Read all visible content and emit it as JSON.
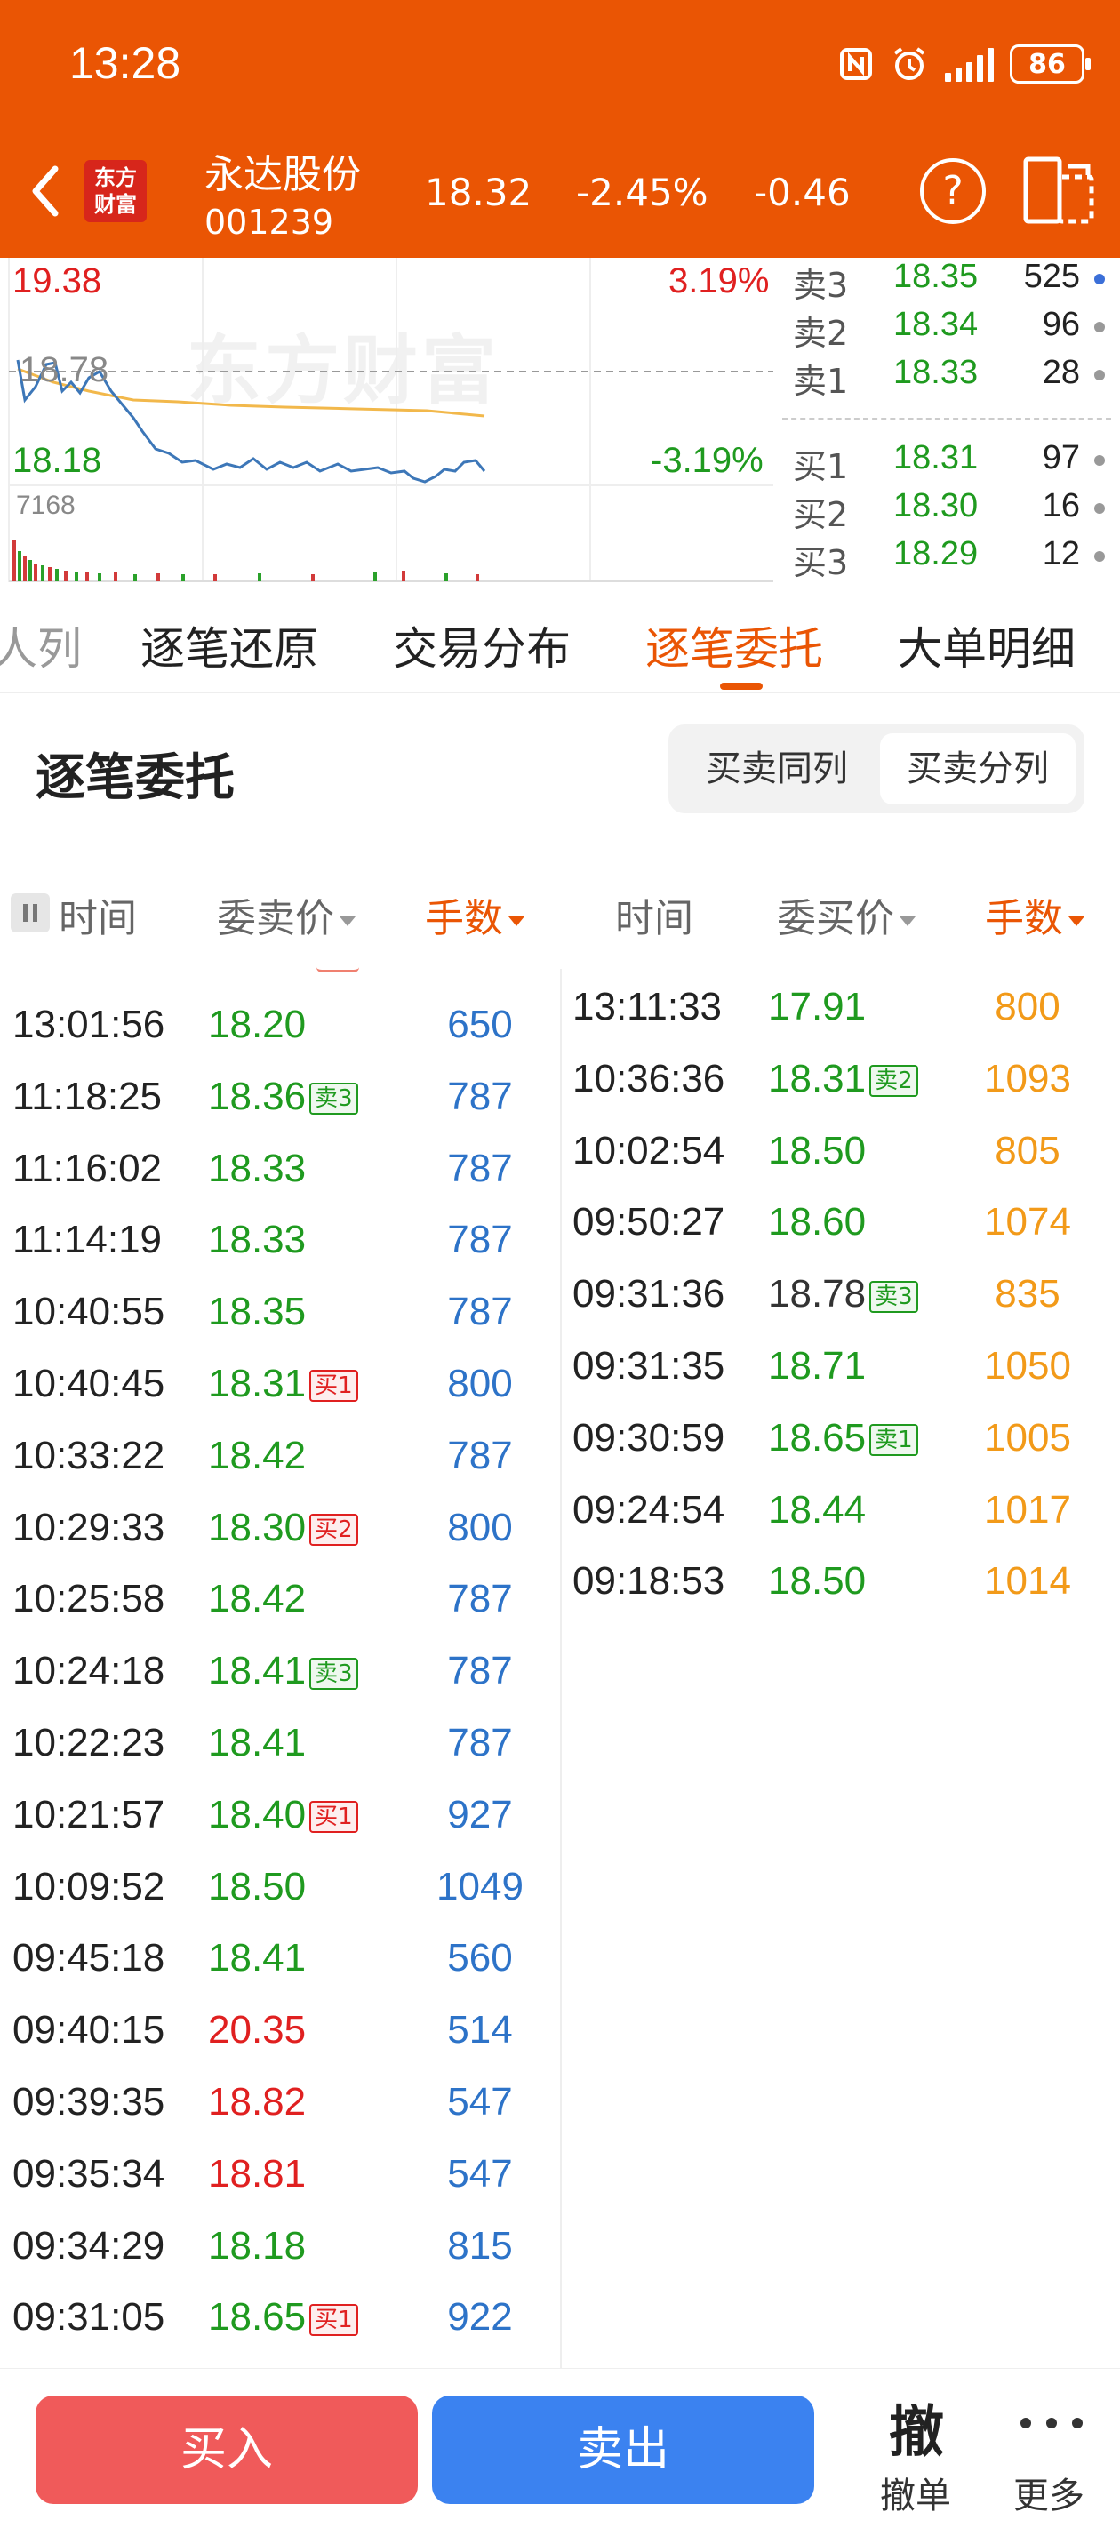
{
  "status_bar": {
    "time": "13:28",
    "battery": "86"
  },
  "stock": {
    "name": "永达股份",
    "code": "001239",
    "price": "18.32",
    "change_pct": "-2.45%",
    "change": "-0.46",
    "logo_text": [
      "东方",
      "财富"
    ]
  },
  "chart": {
    "high_price": "19.38",
    "high_pct": "3.19%",
    "mid_price": "18.78",
    "low_price": "18.18",
    "low_pct": "-3.19%",
    "volume_max": "7168",
    "watermark": "东方财富"
  },
  "order_book": {
    "asks": [
      {
        "label": "卖3",
        "price": "18.35",
        "volume": "525",
        "dot_color": "#3B6FD8"
      },
      {
        "label": "卖2",
        "price": "18.34",
        "volume": "96",
        "dot_color": "#999999"
      },
      {
        "label": "卖1",
        "price": "18.33",
        "volume": "28",
        "dot_color": "#999999"
      }
    ],
    "bids": [
      {
        "label": "买1",
        "price": "18.31",
        "volume": "97",
        "dot_color": "#999999"
      },
      {
        "label": "买2",
        "price": "18.30",
        "volume": "16",
        "dot_color": "#999999"
      },
      {
        "label": "买3",
        "price": "18.29",
        "volume": "12",
        "dot_color": "#999999"
      }
    ]
  },
  "tabs": [
    "人列",
    "逐笔还原",
    "交易分布",
    "逐笔委托",
    "大单明细"
  ],
  "tab_cut": "人列",
  "section": {
    "title": "逐笔委托",
    "toggle": [
      "买卖同列",
      "买卖分列"
    ]
  },
  "columns": {
    "sell": {
      "time": "时间",
      "price": "委卖价",
      "qty": "手数"
    },
    "buy": {
      "time": "时间",
      "price": "委买价",
      "qty": "手数"
    }
  },
  "sell_orders": [
    {
      "time": "13:01:56",
      "price": "18.20",
      "tag": "",
      "qty": "650",
      "color": "green"
    },
    {
      "time": "11:18:25",
      "price": "18.36",
      "tag": "卖3",
      "qty": "787",
      "color": "green"
    },
    {
      "time": "11:16:02",
      "price": "18.33",
      "tag": "",
      "qty": "787",
      "color": "green"
    },
    {
      "time": "11:14:19",
      "price": "18.33",
      "tag": "",
      "qty": "787",
      "color": "green"
    },
    {
      "time": "10:40:55",
      "price": "18.35",
      "tag": "",
      "qty": "787",
      "color": "green"
    },
    {
      "time": "10:40:45",
      "price": "18.31",
      "tag": "买1",
      "qty": "800",
      "color": "green"
    },
    {
      "time": "10:33:22",
      "price": "18.42",
      "tag": "",
      "qty": "787",
      "color": "green"
    },
    {
      "time": "10:29:33",
      "price": "18.30",
      "tag": "买2",
      "qty": "800",
      "color": "green"
    },
    {
      "time": "10:25:58",
      "price": "18.42",
      "tag": "",
      "qty": "787",
      "color": "green"
    },
    {
      "time": "10:24:18",
      "price": "18.41",
      "tag": "卖3",
      "qty": "787",
      "color": "green"
    },
    {
      "time": "10:22:23",
      "price": "18.41",
      "tag": "",
      "qty": "787",
      "color": "green"
    },
    {
      "time": "10:21:57",
      "price": "18.40",
      "tag": "买1",
      "qty": "927",
      "color": "green"
    },
    {
      "time": "10:09:52",
      "price": "18.50",
      "tag": "",
      "qty": "1049",
      "color": "green"
    },
    {
      "time": "09:45:18",
      "price": "18.41",
      "tag": "",
      "qty": "560",
      "color": "green"
    },
    {
      "time": "09:40:15",
      "price": "20.35",
      "tag": "",
      "qty": "514",
      "color": "red"
    },
    {
      "time": "09:39:35",
      "price": "18.82",
      "tag": "",
      "qty": "547",
      "color": "red"
    },
    {
      "time": "09:35:34",
      "price": "18.81",
      "tag": "",
      "qty": "547",
      "color": "red"
    },
    {
      "time": "09:34:29",
      "price": "18.18",
      "tag": "",
      "qty": "815",
      "color": "green"
    },
    {
      "time": "09:31:05",
      "price": "18.65",
      "tag": "买1",
      "qty": "922",
      "color": "green"
    }
  ],
  "buy_orders": [
    {
      "time": "13:11:33",
      "price": "17.91",
      "tag": "",
      "qty": "800",
      "color": "green"
    },
    {
      "time": "10:36:36",
      "price": "18.31",
      "tag": "卖2",
      "qty": "1093",
      "color": "green"
    },
    {
      "time": "10:02:54",
      "price": "18.50",
      "tag": "",
      "qty": "805",
      "color": "green"
    },
    {
      "time": "09:50:27",
      "price": "18.60",
      "tag": "",
      "qty": "1074",
      "color": "green"
    },
    {
      "time": "09:31:36",
      "price": "18.78",
      "tag": "卖3",
      "qty": "835",
      "color": "dark"
    },
    {
      "time": "09:31:35",
      "price": "18.71",
      "tag": "",
      "qty": "1050",
      "color": "green"
    },
    {
      "time": "09:30:59",
      "price": "18.65",
      "tag": "卖1",
      "qty": "1005",
      "color": "green"
    },
    {
      "time": "09:24:54",
      "price": "18.44",
      "tag": "",
      "qty": "1017",
      "color": "green"
    },
    {
      "time": "09:18:53",
      "price": "18.50",
      "tag": "",
      "qty": "1014",
      "color": "green"
    }
  ],
  "bottom_bar": {
    "buy": "买入",
    "sell": "卖出",
    "cancel_icon_text": "撤",
    "cancel": "撤单",
    "more": "更多"
  },
  "colors": {
    "brand": "#EA5504",
    "up": "#E02020",
    "down": "#1F9A1F",
    "sell_qty": "#2D73C8",
    "buy_qty": "#F29A19"
  }
}
